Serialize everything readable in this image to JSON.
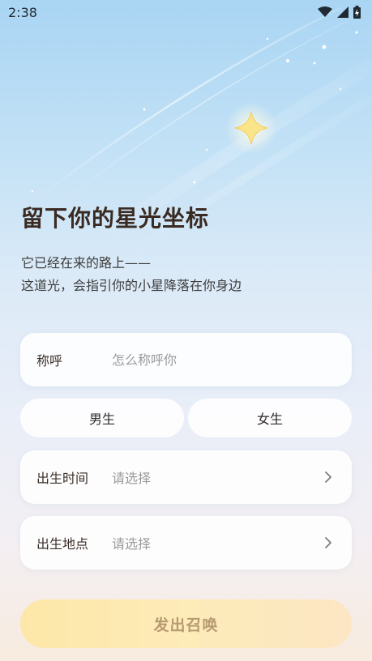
{
  "status_bar": {
    "time": "2:38"
  },
  "heading": {
    "title": "留下你的星光坐标",
    "subtitle_line1": "它已经在来的路上——",
    "subtitle_line2": "这道光，会指引你的小星降落在你身边"
  },
  "form": {
    "nickname": {
      "label": "称呼",
      "placeholder": "怎么称呼你",
      "value": ""
    },
    "gender": {
      "male_label": "男生",
      "female_label": "女生"
    },
    "birth_time": {
      "label": "出生时间",
      "value": "请选择"
    },
    "birth_place": {
      "label": "出生地点",
      "value": "请选择"
    },
    "submit_label": "发出召唤"
  },
  "colors": {
    "accent": "#fde7a8",
    "title": "#3a2a22",
    "placeholder": "#9a9a9a",
    "submit_text": "#b89a72"
  }
}
